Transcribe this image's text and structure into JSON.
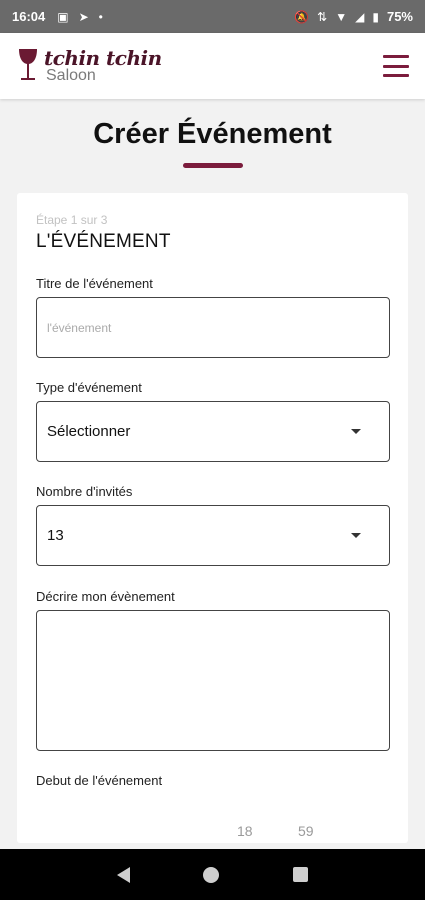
{
  "status_bar": {
    "time": "16:04",
    "battery": "75%"
  },
  "header": {
    "brand_line1": "tchin tchin",
    "brand_line2": "Saloon"
  },
  "page": {
    "title": "Créer Événement"
  },
  "form": {
    "step": "Étape 1 sur 3",
    "section_title": "L'ÉVÉNEMENT",
    "title_label": "Titre de l'événement",
    "title_placeholder": "l'événement",
    "type_label": "Type d'événement",
    "type_value": "Sélectionner",
    "guests_label": "Nombre d'invités",
    "guests_value": "13",
    "description_label": "Décrire mon évènement",
    "start_label": "Debut de l'événement",
    "start_hour": "18",
    "start_minute": "59"
  }
}
